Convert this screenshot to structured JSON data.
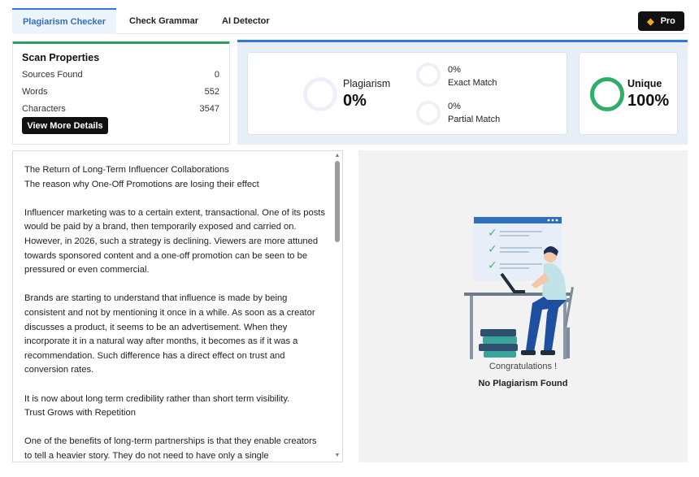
{
  "tabs": [
    {
      "label": "Plagiarism Checker",
      "active": true
    },
    {
      "label": "Check Grammar",
      "active": false
    },
    {
      "label": "AI Detector",
      "active": false
    }
  ],
  "pro_button": {
    "label": "Pro",
    "icon": "diamond-icon"
  },
  "scan": {
    "title": "Scan Properties",
    "rows": [
      {
        "label": "Sources Found",
        "value": "0"
      },
      {
        "label": "Words",
        "value": "552"
      },
      {
        "label": "Characters",
        "value": "3547"
      }
    ],
    "more_button": "View More Details"
  },
  "results": {
    "plagiarism_label": "Plagiarism",
    "plagiarism_value": "0%",
    "exact_value": "0%",
    "exact_label": "Exact Match",
    "partial_value": "0%",
    "partial_label": "Partial Match",
    "unique_label": "Unique",
    "unique_value": "100%",
    "unique_color": "#2fae6a"
  },
  "document": {
    "paragraphs": [
      "The Return of Long-Term Influencer Collaborations",
      "The reason why One-Off Promotions are losing their effect",
      "Influencer marketing was to a certain extent, transactional. One of its posts would be paid by a brand, then temporarily exposed and carried on. However, in 2026, such a strategy is declining. Viewers are more attuned towards sponsored content and a one-off promotion can be seen to be pressured or even commercial.",
      "Brands are starting to understand that influence is made by being consistent and not by mentioning it once in a while. As soon as a creator discusses a product, it seems to be an advertisement. When they incorporate it in a natural way after months, it becomes as if it was a recommendation. Such difference has a direct effect on trust and conversion rates.",
      "It is now about long term credibility rather than short term visibility.",
      "Trust Grows with Repetition",
      "One of the benefits of long-term partnerships is that they enable creators to tell a heavier story. They do not need to have only a single"
    ]
  },
  "status": {
    "congrats": "Congratulations !",
    "message": "No Plagiarism Found"
  }
}
